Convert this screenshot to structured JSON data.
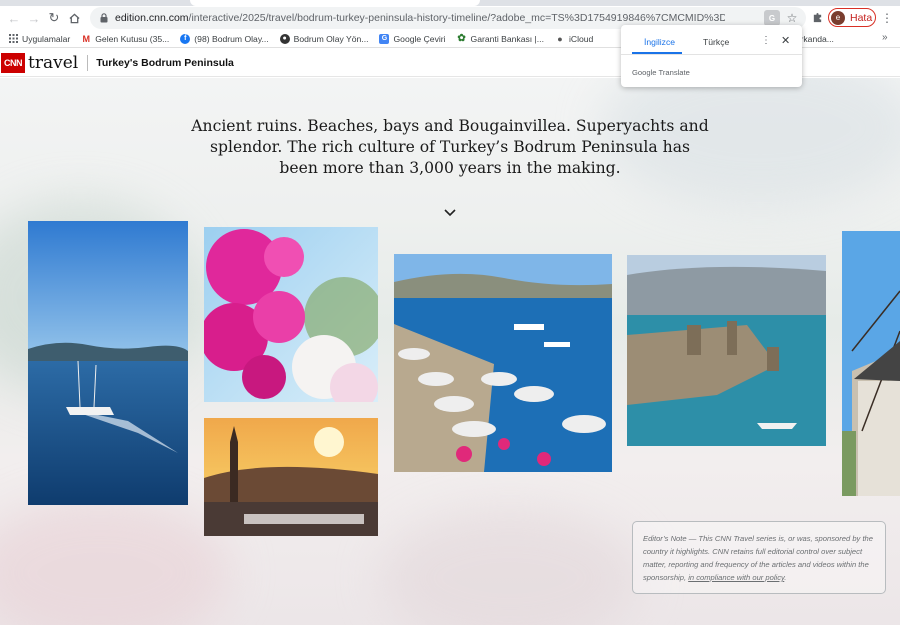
{
  "browser": {
    "url_host": "edition.cnn.com",
    "url_path": "/interactive/2025/travel/bodrum-turkey-peninsula-history-timeline/?adobe_mc=TS%3D1754919846%7CMCMID%3D8289388377858...",
    "profile_initial": "e",
    "profile_status": "Hata"
  },
  "bookmarks": [
    {
      "label": "Uygulamalar",
      "icon": "apps-grid-icon",
      "color": "#5f6368"
    },
    {
      "label": "Gelen Kutusu (35...",
      "icon": "gmail-icon",
      "color": "#d93025"
    },
    {
      "label": "(98) Bodrum Olay...",
      "icon": "facebook-icon",
      "color": "#1877f2"
    },
    {
      "label": "Bodrum Olay Yön...",
      "icon": "globe-icon",
      "color": "#333333"
    },
    {
      "label": "Google Çeviri",
      "icon": "google-translate-icon",
      "color": "#4285f4"
    },
    {
      "label": "Garanti Bankası |...",
      "icon": "garanti-icon",
      "color": "#2e7d32"
    },
    {
      "label": "iCloud",
      "icon": "apple-icon",
      "color": "#555555"
    }
  ],
  "bookmarks_overflow_label": "r Arkanda...",
  "translate_popup": {
    "tab_source": "İngilizce",
    "tab_target": "Türkçe",
    "brand_google": "Google",
    "brand_translate": "Translate"
  },
  "cnn": {
    "logo_text": "CNN",
    "section": "travel",
    "article_title": "Turkey's Bodrum Peninsula"
  },
  "intro_text": "Ancient ruins. Beaches, bays and Bougainvillea. Superyachts and splendor. The rich culture of Turkey’s Bodrum Peninsula has been more than 3,000 years in the making.",
  "editors_note": {
    "text": "Editor’s Note — This CNN Travel series is, or was, sponsored by the country it highlights. CNN retains full editorial control over subject matter, reporting and frequency of the articles and videos within the sponsorship,",
    "link": "in compliance with our policy",
    "end": "."
  },
  "photos": [
    {
      "name": "photo-yacht-at-sea"
    },
    {
      "name": "photo-bougainvillea"
    },
    {
      "name": "photo-sunset-minaret"
    },
    {
      "name": "photo-beach-umbrellas"
    },
    {
      "name": "photo-bodrum-castle"
    },
    {
      "name": "photo-windmill"
    }
  ],
  "colors": {
    "cnn_red": "#cc0000",
    "google_blue": "#1a73e8",
    "error_red": "#d93025"
  }
}
